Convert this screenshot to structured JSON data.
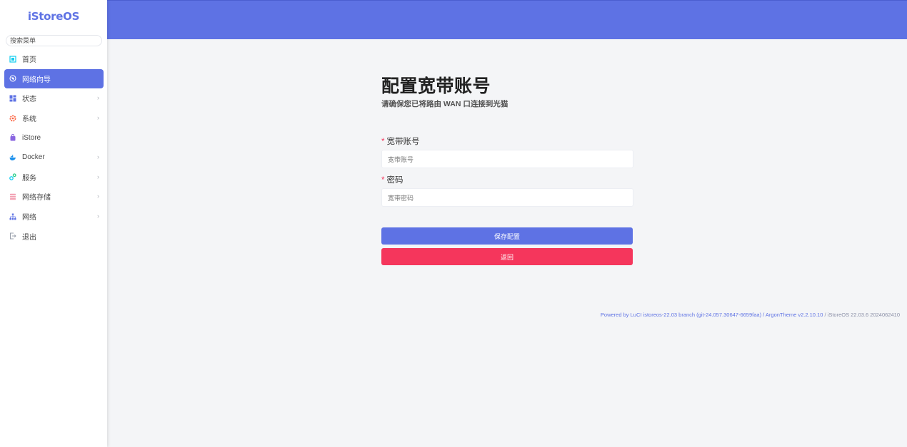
{
  "sidebar": {
    "brand": "iStoreOS",
    "search_placeholder": "搜索菜单",
    "items": [
      {
        "label": "首页",
        "icon": "home-icon",
        "active": false,
        "expandable": false
      },
      {
        "label": "网络向导",
        "icon": "compass-icon",
        "active": true,
        "expandable": false
      },
      {
        "label": "状态",
        "icon": "dashboard-icon",
        "active": false,
        "expandable": true
      },
      {
        "label": "系统",
        "icon": "gear-icon",
        "active": false,
        "expandable": true
      },
      {
        "label": "iStore",
        "icon": "store-bag-icon",
        "active": false,
        "expandable": false
      },
      {
        "label": "Docker",
        "icon": "docker-whale-icon",
        "active": false,
        "expandable": true
      },
      {
        "label": "服务",
        "icon": "services-gears-icon",
        "active": false,
        "expandable": true
      },
      {
        "label": "网络存储",
        "icon": "storage-stack-icon",
        "active": false,
        "expandable": true
      },
      {
        "label": "网络",
        "icon": "network-tree-icon",
        "active": false,
        "expandable": true
      },
      {
        "label": "退出",
        "icon": "logout-icon",
        "active": false,
        "expandable": false
      }
    ]
  },
  "main": {
    "title": "配置宽带账号",
    "subtitle": "请确保您已将路由 WAN 口连接到光猫",
    "fields": {
      "account": {
        "required_mark": "*",
        "label": "宽带账号",
        "placeholder": "宽带账号"
      },
      "password": {
        "required_mark": "*",
        "label": "密码",
        "placeholder": "宽带密码"
      }
    },
    "buttons": {
      "save": "保存配置",
      "back": "返回"
    }
  },
  "footer": {
    "powered_prefix": "Powered by ",
    "luci": "LuCI istoreos-22.03 branch (git-24.057.30647-6659faa)",
    "separator1": " / ",
    "theme": "ArgonTheme v2.2.10.10",
    "separator2": " / ",
    "version": "iStoreOS 22.03.6 2024062410"
  },
  "colors": {
    "accent": "#5e72e4",
    "danger": "#f5365c",
    "background": "#f4f5f7"
  }
}
